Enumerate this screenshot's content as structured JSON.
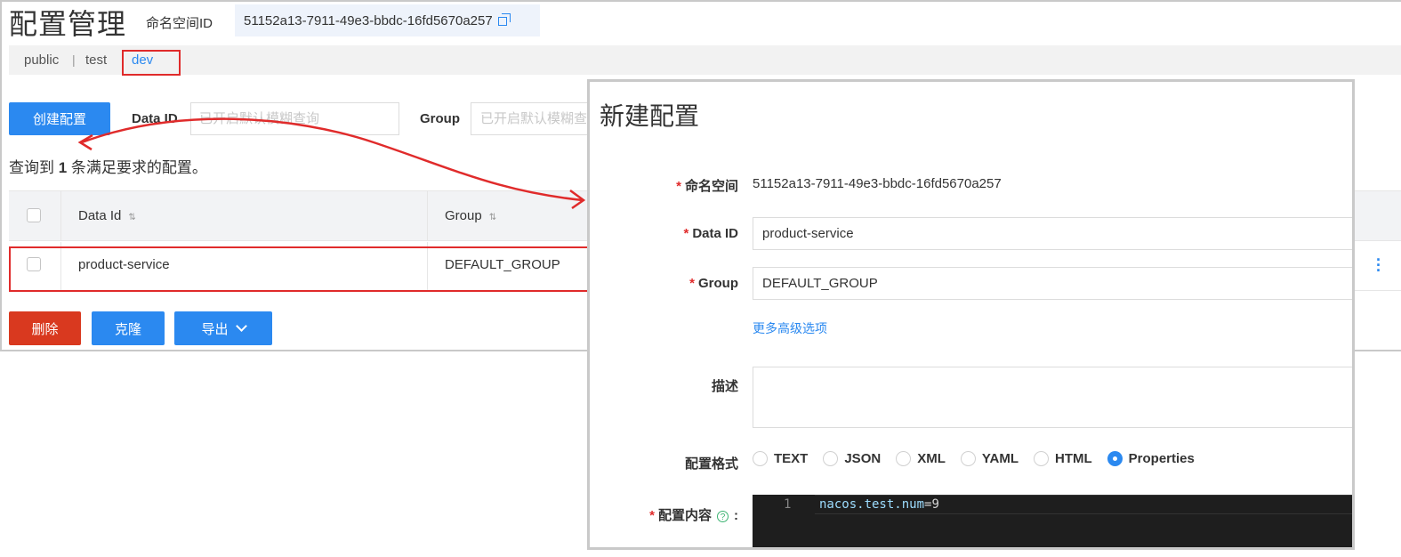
{
  "header": {
    "title": "配置管理",
    "namespace_label": "命名空间ID",
    "namespace_id": "51152a13-7911-49e3-bbdc-16fd5670a257"
  },
  "namespace_tabs": {
    "public": "public",
    "separator": "|",
    "test": "test",
    "dev": "dev",
    "active": "dev"
  },
  "toolbar": {
    "create_label": "创建配置",
    "dataid_label": "Data ID",
    "dataid_placeholder": "已开启默认模糊查询",
    "group_label": "Group",
    "group_placeholder": "已开启默认模糊查询"
  },
  "result": {
    "prefix": "查询到 ",
    "count": "1",
    "suffix": " 条满足要求的配置。"
  },
  "table": {
    "columns": [
      "Data Id",
      "Group"
    ],
    "rows": [
      {
        "data_id": "product-service",
        "group": "DEFAULT_GROUP",
        "checked": false
      }
    ]
  },
  "actions": {
    "delete_label": "删除",
    "clone_label": "克隆",
    "export_label": "导出"
  },
  "dialog": {
    "title": "新建配置",
    "namespace_label": "命名空间",
    "namespace_value": "51152a13-7911-49e3-bbdc-16fd5670a257",
    "dataid_label": "Data ID",
    "dataid_value": "product-service",
    "group_label": "Group",
    "group_value": "DEFAULT_GROUP",
    "advanced_link": "更多高级选项",
    "desc_label": "描述",
    "desc_value": "",
    "format_label": "配置格式",
    "formats": [
      "TEXT",
      "JSON",
      "XML",
      "YAML",
      "HTML",
      "Properties"
    ],
    "selected_format": "Properties",
    "content_label": "配置内容",
    "content_help_icon": "?",
    "content_colon": ":",
    "editor": {
      "line_number": "1",
      "code_key": "nacos.test.num",
      "code_rest": "=9"
    }
  },
  "colors": {
    "primary": "#2b89f0",
    "danger": "#d9391f",
    "highlight_box": "#e02b2b",
    "editor_bg": "#1e1e1e"
  }
}
